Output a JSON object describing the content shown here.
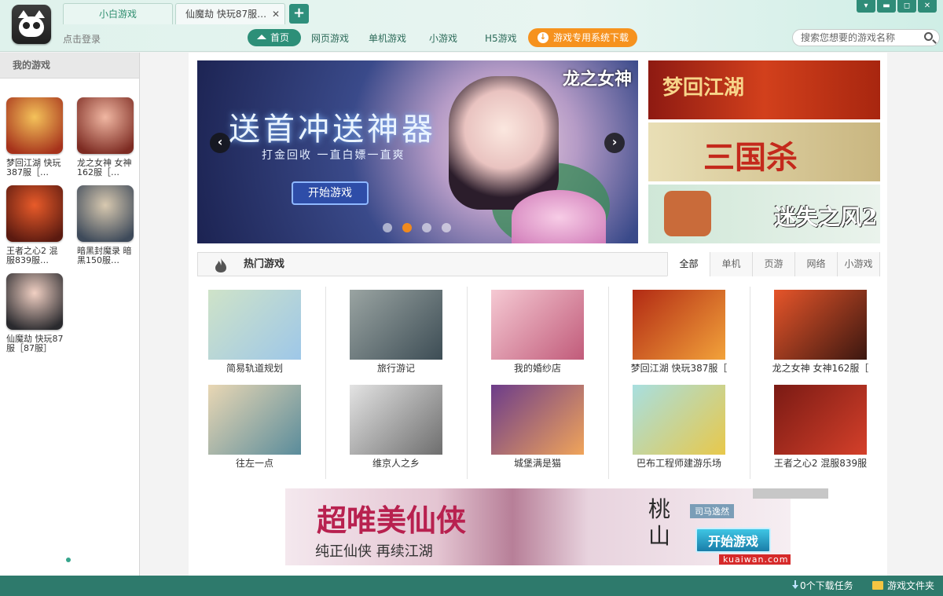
{
  "tabs": {
    "active": "小白游戏",
    "second": "仙魔劫  快玩87服…",
    "close": "✕",
    "add": "+"
  },
  "window": {
    "menu": "▾",
    "minimize": "▬",
    "maximize": "◻",
    "close": "✕"
  },
  "login": "点击登录",
  "nav": {
    "home": "首页",
    "items": [
      "网页游戏",
      "单机游戏",
      "小游戏",
      "H5游戏"
    ],
    "download": "游戏专用系统下载"
  },
  "search": {
    "placeholder": "搜索您想要的游戏名称"
  },
  "sidebar": {
    "title": "我的游戏",
    "games": [
      {
        "name": "梦回江湖 快玩387服［…",
        "color1": "#f4c25a",
        "color2": "#a6321b"
      },
      {
        "name": "龙之女神 女神162服［…",
        "color1": "#f0b7a2",
        "color2": "#7d2b22"
      },
      {
        "name": "王者之心2 混服839服…",
        "color1": "#e85b2a",
        "color2": "#5b1a10"
      },
      {
        "name": "暗黑封魔录 暗黑150服…",
        "color1": "#d8c9b0",
        "color2": "#3e4a5a"
      },
      {
        "name": "仙魔劫 快玩87服［87服］",
        "color1": "#f1d0c3",
        "color2": "#2a2a2e"
      }
    ]
  },
  "banner": {
    "headline": "送首冲送神器",
    "sub": "打金回收 一直白嫖一直爽",
    "start": "开始游戏",
    "brand": "龙之女神",
    "prev": "‹",
    "next": "›"
  },
  "side_banners": [
    "梦回江湖",
    "三国杀",
    "迷失之风2"
  ],
  "hot": {
    "title": "热门游戏",
    "tabs": [
      "全部",
      "单机",
      "页游",
      "网络",
      "小游戏"
    ],
    "games": [
      {
        "label": "简易轨道规划",
        "c1": "#cfe3c8",
        "c2": "#9ec7e8"
      },
      {
        "label": "旅行游记",
        "c1": "#9aa4a2",
        "c2": "#3d4d55"
      },
      {
        "label": "我的婚纱店",
        "c1": "#f5c9d3",
        "c2": "#c15b7a"
      },
      {
        "label": "梦回江湖 快玩387服［",
        "c1": "#b22a14",
        "c2": "#f2a23a"
      },
      {
        "label": "龙之女神 女神162服［",
        "c1": "#e6552a",
        "c2": "#3b1710"
      },
      {
        "label": "往左一点",
        "c1": "#e9d7b4",
        "c2": "#5a8c9b"
      },
      {
        "label": "维京人之乡",
        "c1": "#e3e3e3",
        "c2": "#6e6e6e"
      },
      {
        "label": "城堡满是猫",
        "c1": "#6c3c8a",
        "c2": "#f0a45a"
      },
      {
        "label": "巴布工程师建游乐场",
        "c1": "#a8dfe0",
        "c2": "#e8c84a"
      },
      {
        "label": "王者之心2 混服839服",
        "c1": "#7a1a14",
        "c2": "#d4402a"
      }
    ]
  },
  "ad": {
    "title": "超唯美仙侠",
    "sub": "纯正仙侠 再续江湖",
    "vertical": "桃山",
    "player": "司马逸然",
    "start": "开始游戏",
    "url": "kuaiwan.com"
  },
  "status": {
    "downloads": "0个下载任务",
    "folder": "游戏文件夹"
  },
  "colors": {
    "accent": "#2d8f78",
    "orange": "#f6921e",
    "status_bg": "#2e7a6c"
  }
}
